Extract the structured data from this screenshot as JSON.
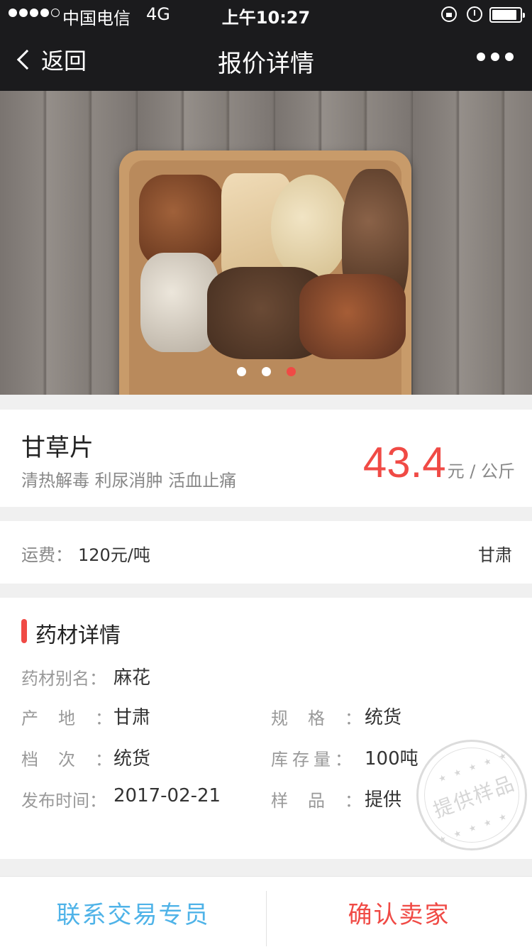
{
  "status_bar": {
    "carrier": "中国电信",
    "network": "4G",
    "time": "上午10:27",
    "icons": [
      "signal-icon",
      "lock-icon",
      "alarm-icon",
      "battery-icon"
    ]
  },
  "nav": {
    "back_label": "返回",
    "title": "报价详情",
    "more_icon": "more-icon"
  },
  "banner": {
    "slide_count": 3,
    "active_slide": 3
  },
  "product": {
    "name": "甘草片",
    "description": "清热解毒 利尿消肿 活血止痛",
    "price": "43.4",
    "price_unit": "元 / 公斤"
  },
  "shipping": {
    "label": "运费：",
    "value": "120元/吨",
    "origin": "甘肃"
  },
  "details": {
    "title": "药材详情",
    "rows": [
      {
        "label": "药材别名：",
        "value": "麻花"
      },
      {
        "label": "产地：",
        "value": "甘肃"
      },
      {
        "label": "规格：",
        "value": "统货"
      },
      {
        "label": "档次：",
        "value": "统货"
      },
      {
        "label": "库存量：",
        "value": "100吨"
      },
      {
        "label": "发布时间：",
        "value": "2017-02-21"
      },
      {
        "label": "样品：",
        "value": "提供"
      }
    ],
    "stamp_text": "提供样品"
  },
  "actions": {
    "contact": "联系交易专员",
    "confirm": "确认卖家"
  },
  "colors": {
    "accent": "#f04a45",
    "link_blue": "#4fb3e8",
    "nav_bg": "#1b1b1d",
    "page_bg": "#f0f0f0"
  }
}
